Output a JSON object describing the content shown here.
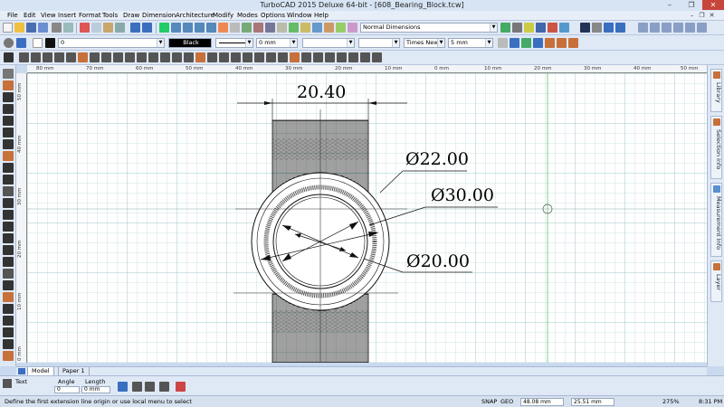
{
  "window": {
    "title": "TurboCAD 2015 Deluxe 64-bit - [608_Bearing_Block.tcw]",
    "minimize": "–",
    "maximize": "❐",
    "close": "✕"
  },
  "menu": {
    "items": [
      "File",
      "Edit",
      "View",
      "Insert",
      "Format",
      "Tools",
      "Draw",
      "Dimension",
      "Architecture",
      "Modify",
      "Modes",
      "Options",
      "Window",
      "Help"
    ],
    "mdi_controls": [
      "–",
      "❐",
      "✕"
    ]
  },
  "toolbar1": {
    "dim_style": "Normal Dimensions"
  },
  "toolbar2": {
    "layer_value": "0",
    "color_name": "Black",
    "line_width": "0 mm",
    "font_name": "Times New Ro",
    "text_height": "5 mm"
  },
  "ruler": {
    "top_labels": [
      "80 mm",
      "70 mm",
      "60 mm",
      "50 mm",
      "40 mm",
      "30 mm",
      "20 mm",
      "10 mm",
      "0 mm",
      "10 mm",
      "20 mm",
      "30 mm",
      "40 mm",
      "50 mm",
      "60 mm",
      "70 mm",
      "80 mm"
    ],
    "left_labels": [
      "50 mm",
      "40 mm",
      "30 mm",
      "20 mm",
      "10 mm",
      "0 mm",
      "10 mm",
      "20 mm",
      "30 mm",
      "40 mm",
      "50 mm"
    ]
  },
  "drawing": {
    "dim_top": "20.40",
    "dim_d1": "Ø22.00",
    "dim_d2": "Ø30.00",
    "dim_d3": "Ø20.00"
  },
  "right_panels": [
    "Library",
    "Selection Info",
    "Measurement Info",
    "Layer"
  ],
  "tabs": {
    "model": "Model",
    "paper": "Paper 1"
  },
  "inspector": {
    "text_label": "Text",
    "angle_label": "Angle",
    "angle_value": "0",
    "length_label": "Length",
    "length_value": "0 mm"
  },
  "status": {
    "prompt": "Define the first extension line origin or use local menu to select",
    "snap": "SNAP",
    "geo": "GEO",
    "x_coord": "48.08 mm",
    "y_coord": "25.51 mm",
    "zoom": "275%",
    "time": "8:31 PM"
  },
  "colors": {
    "grid_minor": "#cfe3e3",
    "grid_major": "#9fc9c9",
    "axis_line": "#7fd07f",
    "titlebar_bg": "#d7e4f4",
    "ui_panel": "#dfe8f5"
  }
}
